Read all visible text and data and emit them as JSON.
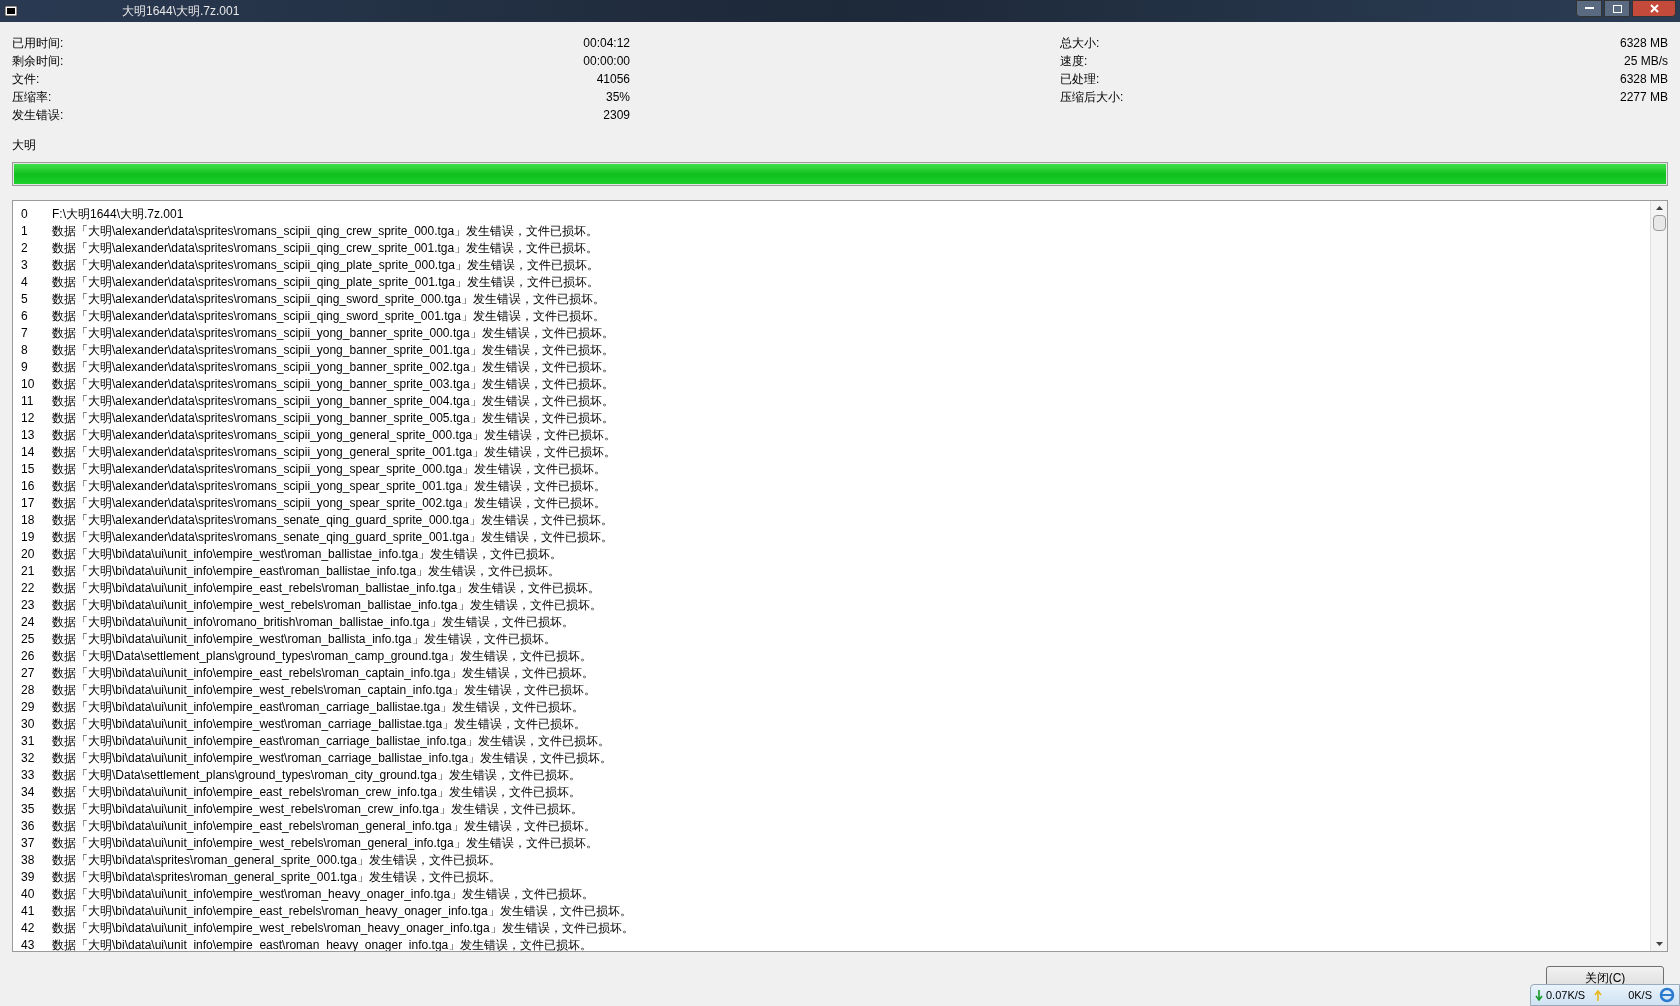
{
  "window": {
    "title": "大明1644\\大明.7z.001"
  },
  "stats_left": [
    {
      "label": "已用时间:",
      "value": "00:04:12"
    },
    {
      "label": "剩余时间:",
      "value": "00:00:00"
    },
    {
      "label": "文件:",
      "value": "41056"
    },
    {
      "label": "压缩率:",
      "value": "35%"
    },
    {
      "label": "发生错误:",
      "value": "2309"
    }
  ],
  "stats_right": [
    {
      "label": "总大小:",
      "value": "6328 MB"
    },
    {
      "label": "速度:",
      "value": "25 MB/s"
    },
    {
      "label": "已处理:",
      "value": "6328 MB"
    },
    {
      "label": "压缩后大小:",
      "value": "2277 MB"
    }
  ],
  "current_item": "大明",
  "progress": {
    "level": 1
  },
  "log": [
    {
      "n": "0",
      "text": "F:\\大明1644\\大明.7z.001"
    },
    {
      "n": "1",
      "text": "数据「大明\\alexander\\data\\sprites\\romans_scipii_qing_crew_sprite_000.tga」发生错误，文件已损坏。"
    },
    {
      "n": "2",
      "text": "数据「大明\\alexander\\data\\sprites\\romans_scipii_qing_crew_sprite_001.tga」发生错误，文件已损坏。"
    },
    {
      "n": "3",
      "text": "数据「大明\\alexander\\data\\sprites\\romans_scipii_qing_plate_sprite_000.tga」发生错误，文件已损坏。"
    },
    {
      "n": "4",
      "text": "数据「大明\\alexander\\data\\sprites\\romans_scipii_qing_plate_sprite_001.tga」发生错误，文件已损坏。"
    },
    {
      "n": "5",
      "text": "数据「大明\\alexander\\data\\sprites\\romans_scipii_qing_sword_sprite_000.tga」发生错误，文件已损坏。"
    },
    {
      "n": "6",
      "text": "数据「大明\\alexander\\data\\sprites\\romans_scipii_qing_sword_sprite_001.tga」发生错误，文件已损坏。"
    },
    {
      "n": "7",
      "text": "数据「大明\\alexander\\data\\sprites\\romans_scipii_yong_banner_sprite_000.tga」发生错误，文件已损坏。"
    },
    {
      "n": "8",
      "text": "数据「大明\\alexander\\data\\sprites\\romans_scipii_yong_banner_sprite_001.tga」发生错误，文件已损坏。"
    },
    {
      "n": "9",
      "text": "数据「大明\\alexander\\data\\sprites\\romans_scipii_yong_banner_sprite_002.tga」发生错误，文件已损坏。"
    },
    {
      "n": "10",
      "text": "数据「大明\\alexander\\data\\sprites\\romans_scipii_yong_banner_sprite_003.tga」发生错误，文件已损坏。"
    },
    {
      "n": "11",
      "text": "数据「大明\\alexander\\data\\sprites\\romans_scipii_yong_banner_sprite_004.tga」发生错误，文件已损坏。"
    },
    {
      "n": "12",
      "text": "数据「大明\\alexander\\data\\sprites\\romans_scipii_yong_banner_sprite_005.tga」发生错误，文件已损坏。"
    },
    {
      "n": "13",
      "text": "数据「大明\\alexander\\data\\sprites\\romans_scipii_yong_general_sprite_000.tga」发生错误，文件已损坏。"
    },
    {
      "n": "14",
      "text": "数据「大明\\alexander\\data\\sprites\\romans_scipii_yong_general_sprite_001.tga」发生错误，文件已损坏。"
    },
    {
      "n": "15",
      "text": "数据「大明\\alexander\\data\\sprites\\romans_scipii_yong_spear_sprite_000.tga」发生错误，文件已损坏。"
    },
    {
      "n": "16",
      "text": "数据「大明\\alexander\\data\\sprites\\romans_scipii_yong_spear_sprite_001.tga」发生错误，文件已损坏。"
    },
    {
      "n": "17",
      "text": "数据「大明\\alexander\\data\\sprites\\romans_scipii_yong_spear_sprite_002.tga」发生错误，文件已损坏。"
    },
    {
      "n": "18",
      "text": "数据「大明\\alexander\\data\\sprites\\romans_senate_qing_guard_sprite_000.tga」发生错误，文件已损坏。"
    },
    {
      "n": "19",
      "text": "数据「大明\\alexander\\data\\sprites\\romans_senate_qing_guard_sprite_001.tga」发生错误，文件已损坏。"
    },
    {
      "n": "20",
      "text": "数据「大明\\bi\\data\\ui\\unit_info\\empire_west\\roman_ballistae_info.tga」发生错误，文件已损坏。"
    },
    {
      "n": "21",
      "text": "数据「大明\\bi\\data\\ui\\unit_info\\empire_east\\roman_ballistae_info.tga」发生错误，文件已损坏。"
    },
    {
      "n": "22",
      "text": "数据「大明\\bi\\data\\ui\\unit_info\\empire_east_rebels\\roman_ballistae_info.tga」发生错误，文件已损坏。"
    },
    {
      "n": "23",
      "text": "数据「大明\\bi\\data\\ui\\unit_info\\empire_west_rebels\\roman_ballistae_info.tga」发生错误，文件已损坏。"
    },
    {
      "n": "24",
      "text": "数据「大明\\bi\\data\\ui\\unit_info\\romano_british\\roman_ballistae_info.tga」发生错误，文件已损坏。"
    },
    {
      "n": "25",
      "text": "数据「大明\\bi\\data\\ui\\unit_info\\empire_west\\roman_ballista_info.tga」发生错误，文件已损坏。"
    },
    {
      "n": "26",
      "text": "数据「大明\\Data\\settlement_plans\\ground_types\\roman_camp_ground.tga」发生错误，文件已损坏。"
    },
    {
      "n": "27",
      "text": "数据「大明\\bi\\data\\ui\\unit_info\\empire_east_rebels\\roman_captain_info.tga」发生错误，文件已损坏。"
    },
    {
      "n": "28",
      "text": "数据「大明\\bi\\data\\ui\\unit_info\\empire_west_rebels\\roman_captain_info.tga」发生错误，文件已损坏。"
    },
    {
      "n": "29",
      "text": "数据「大明\\bi\\data\\ui\\unit_info\\empire_east\\roman_carriage_ballistae.tga」发生错误，文件已损坏。"
    },
    {
      "n": "30",
      "text": "数据「大明\\bi\\data\\ui\\unit_info\\empire_west\\roman_carriage_ballistae.tga」发生错误，文件已损坏。"
    },
    {
      "n": "31",
      "text": "数据「大明\\bi\\data\\ui\\unit_info\\empire_east\\roman_carriage_ballistae_info.tga」发生错误，文件已损坏。"
    },
    {
      "n": "32",
      "text": "数据「大明\\bi\\data\\ui\\unit_info\\empire_west\\roman_carriage_ballistae_info.tga」发生错误，文件已损坏。"
    },
    {
      "n": "33",
      "text": "数据「大明\\Data\\settlement_plans\\ground_types\\roman_city_ground.tga」发生错误，文件已损坏。"
    },
    {
      "n": "34",
      "text": "数据「大明\\bi\\data\\ui\\unit_info\\empire_east_rebels\\roman_crew_info.tga」发生错误，文件已损坏。"
    },
    {
      "n": "35",
      "text": "数据「大明\\bi\\data\\ui\\unit_info\\empire_west_rebels\\roman_crew_info.tga」发生错误，文件已损坏。"
    },
    {
      "n": "36",
      "text": "数据「大明\\bi\\data\\ui\\unit_info\\empire_east_rebels\\roman_general_info.tga」发生错误，文件已损坏。"
    },
    {
      "n": "37",
      "text": "数据「大明\\bi\\data\\ui\\unit_info\\empire_west_rebels\\roman_general_info.tga」发生错误，文件已损坏。"
    },
    {
      "n": "38",
      "text": "数据「大明\\bi\\data\\sprites\\roman_general_sprite_000.tga」发生错误，文件已损坏。"
    },
    {
      "n": "39",
      "text": "数据「大明\\bi\\data\\sprites\\roman_general_sprite_001.tga」发生错误，文件已损坏。"
    },
    {
      "n": "40",
      "text": "数据「大明\\bi\\data\\ui\\unit_info\\empire_west\\roman_heavy_onager_info.tga」发生错误，文件已损坏。"
    },
    {
      "n": "41",
      "text": "数据「大明\\bi\\data\\ui\\unit_info\\empire_east_rebels\\roman_heavy_onager_info.tga」发生错误，文件已损坏。"
    },
    {
      "n": "42",
      "text": "数据「大明\\bi\\data\\ui\\unit_info\\empire_west_rebels\\roman_heavy_onager_info.tga」发生错误，文件已损坏。"
    },
    {
      "n": "43",
      "text": "数据「大明\\bi\\data\\ui\\unit_info\\empire_east\\roman_heavy_onager_info.tga」发生错误，文件已损坏。"
    }
  ],
  "close_button": "关闭(C)",
  "net_widget": {
    "download": "0.07K/S",
    "upload": "0K/S"
  }
}
